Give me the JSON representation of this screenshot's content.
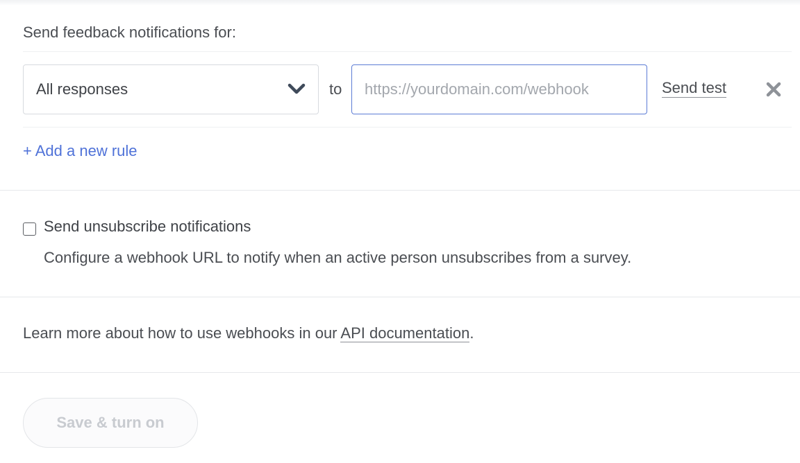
{
  "feedback": {
    "section_title": "Send feedback notifications for:",
    "rule": {
      "select_value": "All responses",
      "to_label": "to",
      "url_placeholder": "https://yourdomain.com/webhook",
      "url_value": "",
      "send_test_label": "Send test"
    },
    "add_rule_label": "+ Add a new rule"
  },
  "unsubscribe": {
    "checked": false,
    "title": "Send unsubscribe notifications",
    "description": "Configure a webhook URL to notify when an active person unsubscribes from a survey."
  },
  "learn_more": {
    "prefix": "Learn more about how to use webhooks in our ",
    "link_text": "API documentation",
    "suffix": "."
  },
  "footer": {
    "save_label": "Save & turn on"
  },
  "icons": {
    "dropdown": "chevron-down-icon",
    "remove": "close-icon"
  },
  "colors": {
    "accent": "#4f72d8",
    "input_focus_border": "#5b7bd5",
    "text": "#3f4247",
    "disabled_text": "#c8cbd0"
  }
}
